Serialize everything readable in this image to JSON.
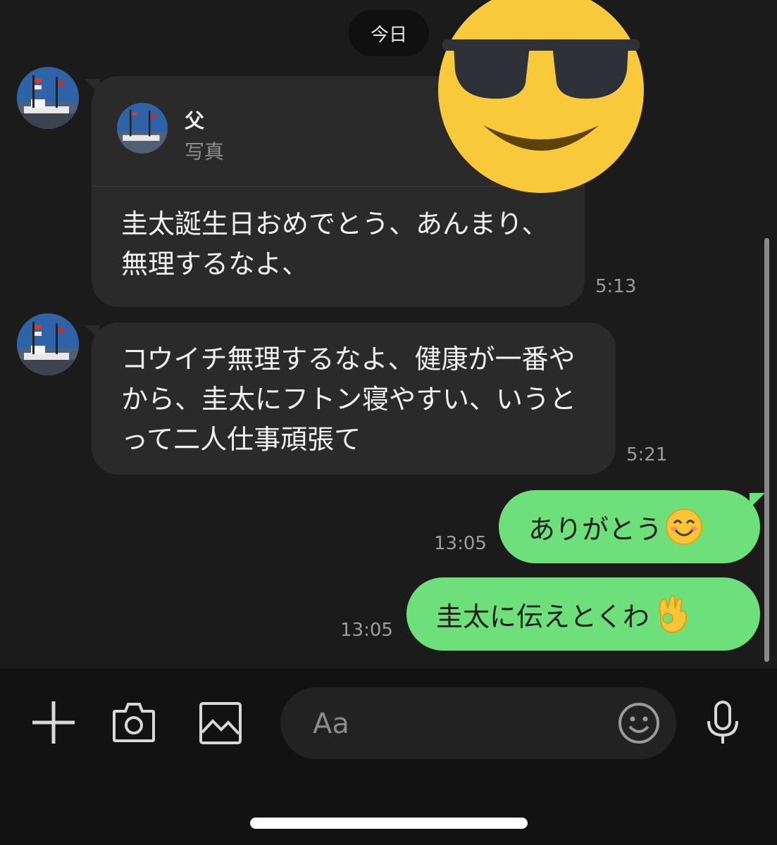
{
  "date_separator": "今日",
  "messages": [
    {
      "side": "incoming",
      "reply": {
        "name": "父",
        "preview": "写真"
      },
      "text": "圭太誕生日おめでとう、あんまり、無理するなよ、",
      "time": "5:13"
    },
    {
      "side": "incoming",
      "text": "コウイチ無理するなよ、健康が一番やから、圭太にフトン寝やすい、いうとって二人仕事頑張て",
      "time": "5:21"
    },
    {
      "side": "outgoing",
      "text": "ありがとう",
      "emoji": "smiling-face-icon",
      "time": "13:05"
    },
    {
      "side": "outgoing",
      "text": "圭太に伝えとくわ",
      "emoji": "ok-hand-icon",
      "time": "13:05"
    }
  ],
  "sticker": "sunglasses-face-icon",
  "composer": {
    "placeholder": "Aa",
    "icons": [
      "plus-icon",
      "camera-icon",
      "image-icon",
      "emoji-icon",
      "microphone-icon"
    ]
  },
  "colors": {
    "background": "#1b1b1b",
    "incoming_bubble": "#2a2a2a",
    "outgoing_bubble": "#6ee07a",
    "composer_background": "#121212"
  }
}
